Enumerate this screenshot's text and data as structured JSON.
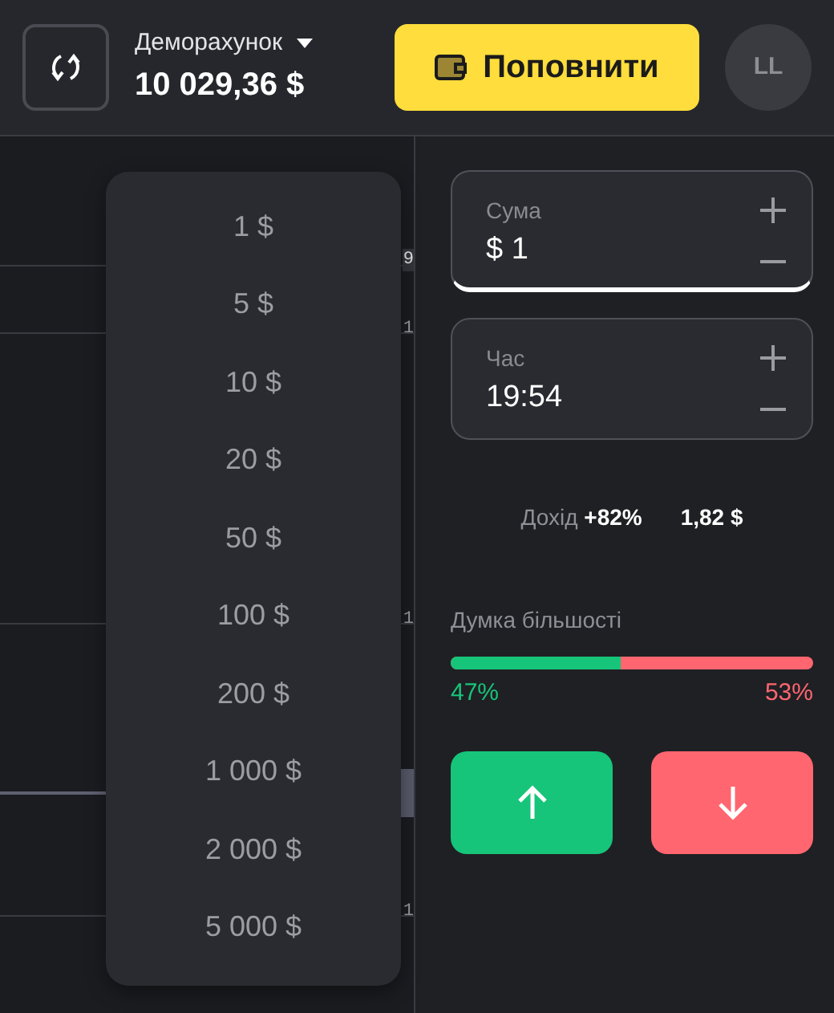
{
  "header": {
    "account_label": "Деморахунок",
    "balance": "10 029,36 $",
    "deposit_button": "Поповнити",
    "avatar": "LL"
  },
  "chart": {
    "price_labels": [
      {
        "text": "9",
        "boxed": true
      },
      {
        "text": "1",
        "boxed": false
      },
      {
        "text": "1",
        "boxed": false
      },
      {
        "text": "1",
        "boxed": false
      }
    ]
  },
  "amount_menu": {
    "options": [
      "1 $",
      "5 $",
      "10 $",
      "20 $",
      "50 $",
      "100 $",
      "200 $",
      "1 000 $",
      "2 000 $",
      "5 000 $"
    ]
  },
  "amount": {
    "label": "Сума",
    "value": "$ 1",
    "focused": true
  },
  "time": {
    "label": "Час",
    "value": "19:54",
    "focused": false
  },
  "payout": {
    "label": "Дохід",
    "percent": "+82%",
    "amount": "1,82 $"
  },
  "sentiment": {
    "label": "Думка більшості",
    "level": 0.47,
    "up": "47%",
    "down": "53%"
  }
}
